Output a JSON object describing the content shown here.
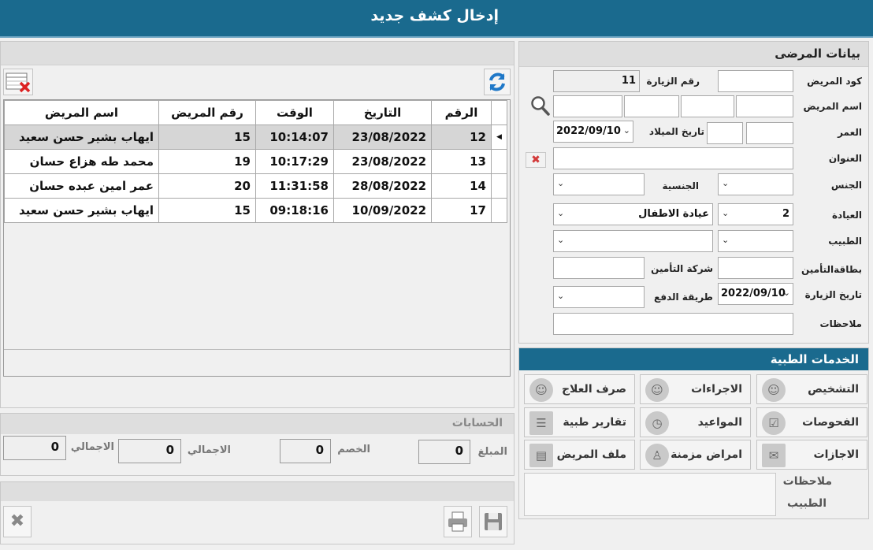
{
  "window": {
    "title": "إدخال كشف جديد"
  },
  "patient": {
    "header": "بيانات المرضى",
    "code_label": "كود المريض",
    "visit_no_label": "رقم الزيارة",
    "visit_no_value": "11",
    "name_label": "اسم المريض",
    "age_label": "العمر",
    "birthdate_label": "تاريخ الميلاد",
    "birthdate_value": "2022/09/10",
    "address_label": "العنوان",
    "gender_label": "الجنس",
    "nationality_label": "الجنسية",
    "clinic_label": "العيادة",
    "clinic_value": "عيادة الاطفال",
    "clinic_code_value": "2",
    "doctor_label": "الطبيب",
    "insurance_card_label": "بطاقةالتأمين",
    "insurance_company_label": "شركة التأمين",
    "visit_date_label": "تاريخ الزيارة",
    "visit_date_value": "2022/09/10",
    "payment_label": "طريقة الدفع",
    "notes_label": "ملاحظات"
  },
  "services": {
    "header": "الخدمات الطبية",
    "buttons": [
      "التشخيص",
      "الاجراءات",
      "صرف العلاج",
      "الفحوصات",
      "المواعيد",
      "تقارير طبية",
      "الاجازات",
      "امراض مزمنة",
      "ملف المريض"
    ],
    "doctor_notes_label_1": "ملاحظات",
    "doctor_notes_label_2": "الطبيب"
  },
  "visits_table": {
    "columns": [
      "الرقم",
      "التاريخ",
      "الوقت",
      "رقم المريض",
      "اسم المريض"
    ],
    "rows": [
      [
        "12",
        "23/08/2022",
        "10:14:07",
        "15",
        "ايهاب بشير حسن سعيد"
      ],
      [
        "13",
        "23/08/2022",
        "10:17:29",
        "19",
        "محمد طه هزاع حسان"
      ],
      [
        "14",
        "28/08/2022",
        "11:31:58",
        "20",
        "عمر  امين عبده حسان"
      ],
      [
        "17",
        "10/09/2022",
        "09:18:16",
        "15",
        "ايهاب بشير حسن سعيد"
      ]
    ]
  },
  "accounts": {
    "header": "الحسابات",
    "amount_label": "المبلغ",
    "amount_value": "0",
    "discount_label": "الخصم",
    "discount_value": "0",
    "total_label": "الاجمالي",
    "total_value": "0",
    "grand_total_label": "الاجمالي",
    "grand_total_value": "0"
  }
}
